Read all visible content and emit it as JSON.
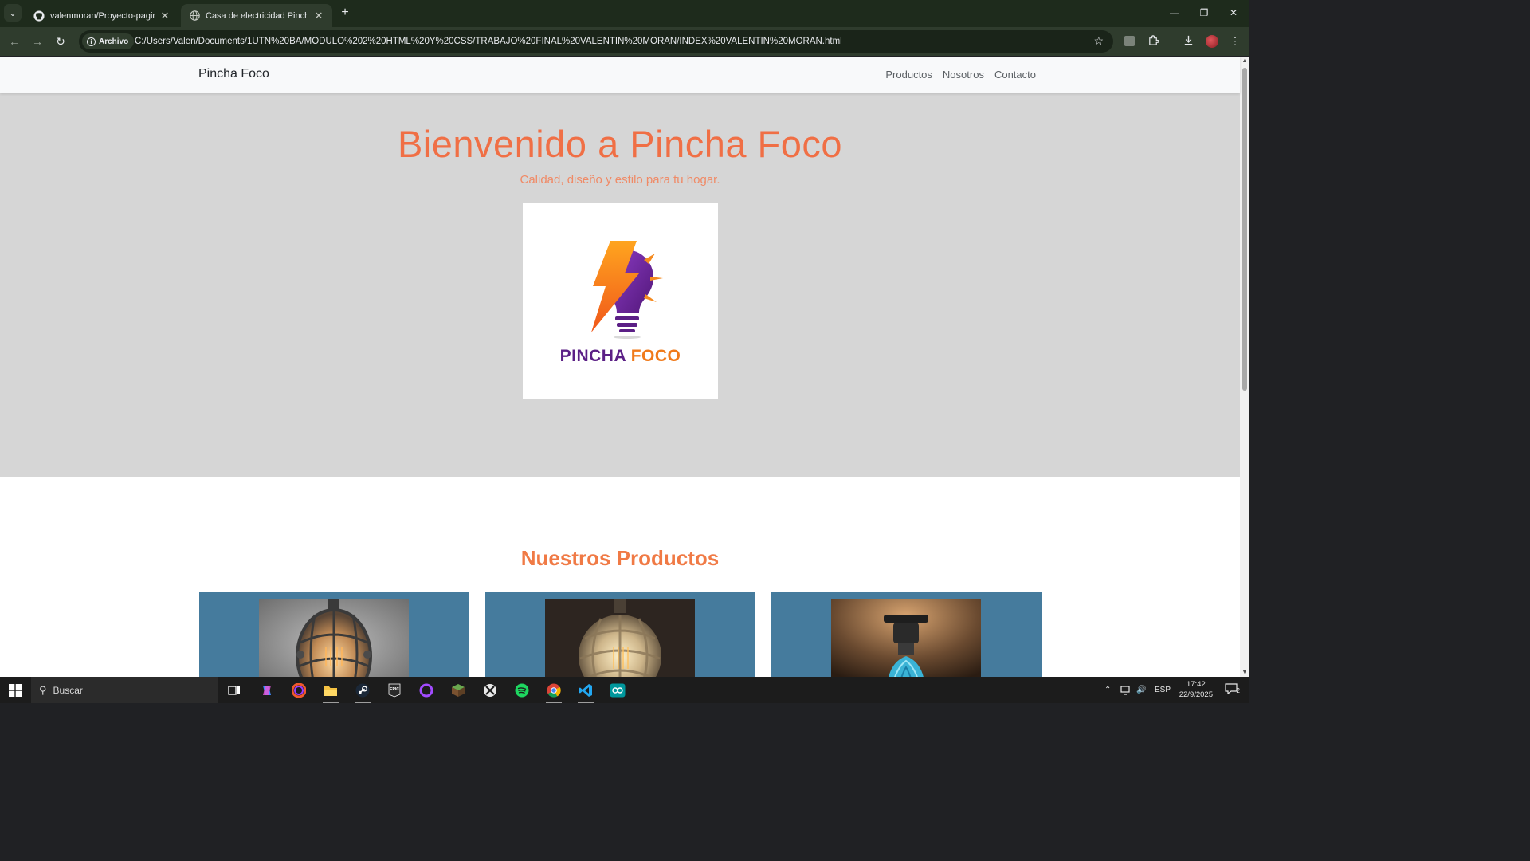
{
  "browser": {
    "tabs": [
      {
        "title": "valenmoran/Proyecto-pagina-d",
        "icon": "github-icon",
        "active": false
      },
      {
        "title": "Casa de electricidad Pincha Foco",
        "icon": "globe-icon",
        "active": true
      }
    ],
    "address": {
      "chip_label": "Archivo",
      "url": "C:/Users/Valen/Documents/1UTN%20BA/MODULO%202%20HTML%20Y%20CSS/TRABAJO%20FINAL%20VALENTIN%20MORAN/INDEX%20VALENTIN%20MORAN.html"
    }
  },
  "site": {
    "brand": "Pincha Foco",
    "nav": [
      {
        "label": "Productos"
      },
      {
        "label": "Nosotros"
      },
      {
        "label": "Contacto"
      }
    ],
    "hero": {
      "title": "Bienvenido a Pincha Foco",
      "subtitle": "Calidad, diseño y estilo para tu hogar.",
      "logo_word_1": "PINCHA",
      "logo_word_2": "FOCO"
    },
    "products": {
      "title": "Nuestros Productos",
      "cards": [
        {
          "image": "vintage-bulb-caged"
        },
        {
          "image": "vintage-bulb-lattice"
        },
        {
          "image": "blue-glass-pendant"
        }
      ]
    },
    "colors": {
      "accent": "#f06f45",
      "hero_bg": "#d6d6d6",
      "card_bg": "#457b9d"
    }
  },
  "taskbar": {
    "search_placeholder": "Buscar",
    "language": "ESP",
    "time": "17:42",
    "date": "22/9/2025",
    "notification_count": "2",
    "apps": [
      "task-view-icon",
      "copilot-icon",
      "opera-icon",
      "file-explorer-icon",
      "steam-icon",
      "epic-games-icon",
      "circle-app-icon",
      "minecraft-icon",
      "xbox-icon",
      "spotify-icon",
      "chrome-icon",
      "vscode-icon",
      "arduino-icon"
    ]
  }
}
